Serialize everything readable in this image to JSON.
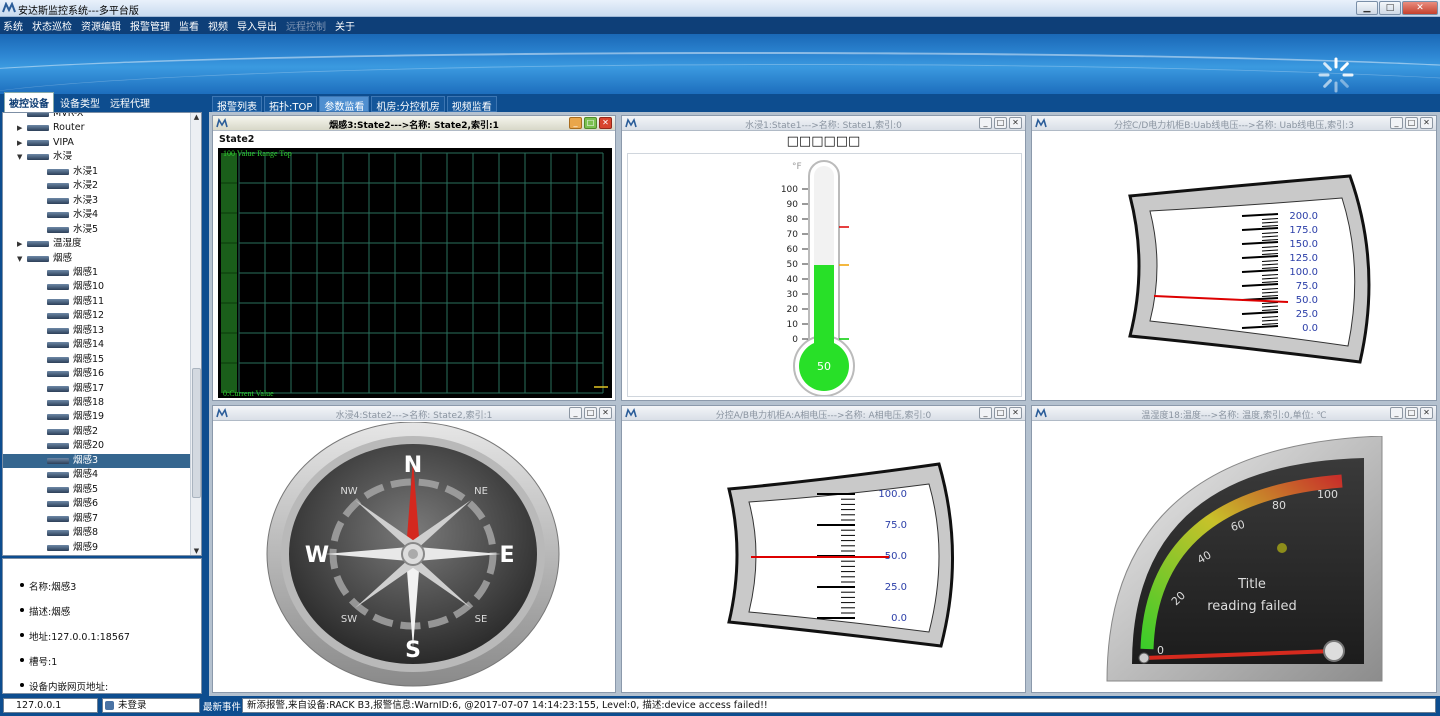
{
  "window": {
    "title": "安达斯监控系统---多平台版",
    "buttons": {
      "minimize": "▁",
      "maximize": "□",
      "close": "✕"
    }
  },
  "menu": [
    "系统",
    "状态巡检",
    "资源编辑",
    "报警管理",
    "监看",
    "视频",
    "导入导出",
    "远程控制",
    "关于"
  ],
  "left_tabs": [
    "被控设备",
    "设备类型",
    "远程代理"
  ],
  "tree": {
    "items": [
      {
        "label": "MVR-X",
        "level": 1,
        "arrow": "",
        "selected": false
      },
      {
        "label": "Router",
        "level": 1,
        "arrow": "▶",
        "selected": false
      },
      {
        "label": "VIPA",
        "level": 1,
        "arrow": "▶",
        "selected": false
      },
      {
        "label": "水浸",
        "level": 1,
        "arrow": "▼",
        "selected": false
      },
      {
        "label": "水浸1",
        "level": 2,
        "arrow": "",
        "selected": false
      },
      {
        "label": "水浸2",
        "level": 2,
        "arrow": "",
        "selected": false
      },
      {
        "label": "水浸3",
        "level": 2,
        "arrow": "",
        "selected": false
      },
      {
        "label": "水浸4",
        "level": 2,
        "arrow": "",
        "selected": false
      },
      {
        "label": "水浸5",
        "level": 2,
        "arrow": "",
        "selected": false
      },
      {
        "label": "温湿度",
        "level": 1,
        "arrow": "▶",
        "selected": false
      },
      {
        "label": "烟感",
        "level": 1,
        "arrow": "▼",
        "selected": false
      },
      {
        "label": "烟感1",
        "level": 2,
        "arrow": "",
        "selected": false
      },
      {
        "label": "烟感10",
        "level": 2,
        "arrow": "",
        "selected": false
      },
      {
        "label": "烟感11",
        "level": 2,
        "arrow": "",
        "selected": false
      },
      {
        "label": "烟感12",
        "level": 2,
        "arrow": "",
        "selected": false
      },
      {
        "label": "烟感13",
        "level": 2,
        "arrow": "",
        "selected": false
      },
      {
        "label": "烟感14",
        "level": 2,
        "arrow": "",
        "selected": false
      },
      {
        "label": "烟感15",
        "level": 2,
        "arrow": "",
        "selected": false
      },
      {
        "label": "烟感16",
        "level": 2,
        "arrow": "",
        "selected": false
      },
      {
        "label": "烟感17",
        "level": 2,
        "arrow": "",
        "selected": false
      },
      {
        "label": "烟感18",
        "level": 2,
        "arrow": "",
        "selected": false
      },
      {
        "label": "烟感19",
        "level": 2,
        "arrow": "",
        "selected": false
      },
      {
        "label": "烟感2",
        "level": 2,
        "arrow": "",
        "selected": false
      },
      {
        "label": "烟感20",
        "level": 2,
        "arrow": "",
        "selected": false
      },
      {
        "label": "烟感3",
        "level": 2,
        "arrow": "",
        "selected": true
      },
      {
        "label": "烟感4",
        "level": 2,
        "arrow": "",
        "selected": false
      },
      {
        "label": "烟感5",
        "level": 2,
        "arrow": "",
        "selected": false
      },
      {
        "label": "烟感6",
        "level": 2,
        "arrow": "",
        "selected": false
      },
      {
        "label": "烟感7",
        "level": 2,
        "arrow": "",
        "selected": false
      },
      {
        "label": "烟感8",
        "level": 2,
        "arrow": "",
        "selected": false
      },
      {
        "label": "烟感9",
        "level": 2,
        "arrow": "",
        "selected": false
      }
    ]
  },
  "props": {
    "name": "名称:烟感3",
    "desc": "描述:烟感",
    "addr": "地址:127.0.0.1:18567",
    "slot": "槽号:1",
    "web": "设备内嵌网页地址:"
  },
  "main_tabs": [
    "报警列表",
    "拓扑:TOP",
    "参数监看",
    "机房:分控机房",
    "视频监看"
  ],
  "panels": {
    "p1": {
      "title": "烟感3:State2--->名称: State2,索引:1",
      "state_label": "State2",
      "scope_top": "100 Value Range Top",
      "scope_bottom": "0:Current Value"
    },
    "p2": {
      "title": "水浸1:State1--->名称: State1,索引:0",
      "unit": "°F",
      "ticks": [
        "100",
        "90",
        "80",
        "70",
        "60",
        "50",
        "40",
        "30",
        "20",
        "10",
        "0"
      ],
      "value": "50",
      "boxes": "□□□□□□"
    },
    "p3": {
      "title": "分控C/D电力机柜B:Uab线电压--->名称: Uab线电压,索引:3",
      "ticks": [
        "200.0",
        "175.0",
        "150.0",
        "125.0",
        "100.0",
        "75.0",
        "50.0",
        "25.0",
        "0.0"
      ]
    },
    "p4": {
      "title": "水浸4:State2--->名称: State2,索引:1",
      "n": "N",
      "s": "S",
      "e": "E",
      "w": "W",
      "ne": "NE",
      "nw": "NW",
      "se": "SE",
      "sw": "SW"
    },
    "p5": {
      "title": "分控A/B电力机柜A:A相电压--->名称: A相电压,索引:0",
      "ticks": [
        "100.0",
        "75.0",
        "50.0",
        "25.0",
        "0.0"
      ]
    },
    "p6": {
      "title": "温湿度18:温度--->名称: 温度,索引:0,单位: ℃",
      "ticks": [
        "0",
        "20",
        "40",
        "60",
        "80",
        "100"
      ],
      "line1": "Title",
      "line2": "reading failed"
    }
  },
  "status": {
    "ip": "127.0.0.1",
    "user": "未登录",
    "event_label": "最新事件:",
    "event": "新添报警,来自设备:RACK B3,报警信息:WarnID:6, @2017-07-07 14:14:23:155, Level:0, 描述:device access failed!!"
  },
  "colors": {
    "accent": "#0d4d8f",
    "selected_row": "#35668f",
    "alarm_red": "#d8452e",
    "scope_green": "#1f7a1f"
  }
}
